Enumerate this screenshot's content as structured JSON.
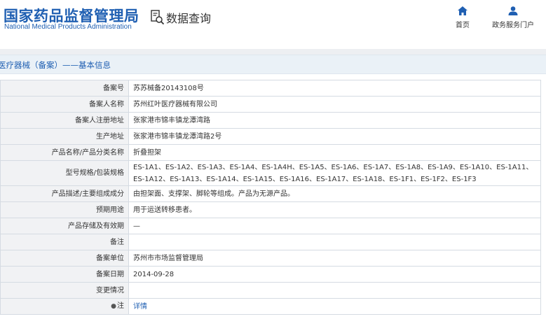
{
  "header": {
    "logo_cn": "国家药品监督管理局",
    "logo_en": "National Medical Products Administration",
    "query_label": "数据查询",
    "nav": {
      "home_label": "首页",
      "portal_label": "政务服务门户"
    }
  },
  "page_title": "医疗器械（备案）——基本信息",
  "colors": {
    "brand_blue": "#1f5fb2",
    "label_bg": "#f1f2f4",
    "title_bar_bg": "#eaf1f7",
    "border": "#d5dbe2"
  },
  "record": {
    "rows": [
      {
        "label": "备案号",
        "value": "苏苏械备20143108号"
      },
      {
        "label": "备案人名称",
        "value": "苏州红叶医疗器械有限公司"
      },
      {
        "label": "备案人注册地址",
        "value": "张家港市锦丰镇龙潭湾路"
      },
      {
        "label": "生产地址",
        "value": "张家港市锦丰镇龙潭湾路2号"
      },
      {
        "label": "产品名称/产品分类名称",
        "value": "折叠担架"
      },
      {
        "label": "型号规格/包装规格",
        "value": "ES-1A1、ES-1A2、ES-1A3、ES-1A4、ES-1A4H、ES-1A5、ES-1A6、ES-1A7、ES-1A8、ES-1A9、ES-1A10、ES-1A11、ES-1A12、ES-1A13、ES-1A14、ES-1A15、ES-1A16、ES-1A17、ES-1A18、ES-1F1、ES-1F2、ES-1F3"
      },
      {
        "label": "产品描述/主要组成成分",
        "value": "由担架面、支撑架、脚轮等组成。产品为无源产品。"
      },
      {
        "label": "预期用途",
        "value": "用于运送转移患者。"
      },
      {
        "label": "产品存储及有效期",
        "value": "—"
      },
      {
        "label": "备注",
        "value": ""
      },
      {
        "label": "备案单位",
        "value": "苏州市市场监督管理局"
      },
      {
        "label": "备案日期",
        "value": "2014-09-28"
      },
      {
        "label": "变更情况",
        "value": ""
      },
      {
        "label": "注",
        "value": "详情"
      }
    ]
  }
}
